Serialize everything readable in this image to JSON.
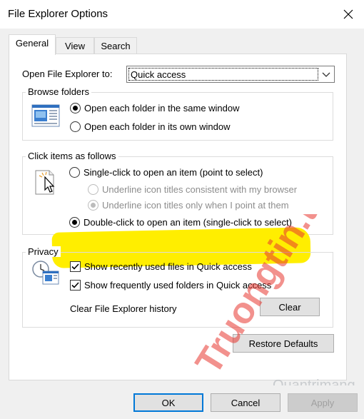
{
  "window": {
    "title": "File Explorer Options"
  },
  "tabs": [
    {
      "label": "General",
      "active": true
    },
    {
      "label": "View",
      "active": false
    },
    {
      "label": "Search",
      "active": false
    }
  ],
  "open_to": {
    "label": "Open File Explorer to:",
    "value": "Quick access"
  },
  "browse_folders": {
    "legend": "Browse folders",
    "options": [
      {
        "label": "Open each folder in the same window",
        "checked": true
      },
      {
        "label": "Open each folder in its own window",
        "checked": false
      }
    ]
  },
  "click_items": {
    "legend": "Click items as follows",
    "single_click": "Single-click to open an item (point to select)",
    "underline_browser": "Underline icon titles consistent with my browser",
    "underline_point": "Underline icon titles only when I point at them",
    "double_click": "Double-click to open an item (single-click to select)",
    "selected": "double_click"
  },
  "privacy": {
    "legend": "Privacy",
    "show_recent_files": "Show recently used files in Quick access",
    "show_frequent_folders": "Show frequently used folders in Quick access",
    "clear_history_label": "Clear File Explorer history",
    "clear_button": "Clear"
  },
  "buttons": {
    "restore_defaults": "Restore Defaults",
    "ok": "OK",
    "cancel": "Cancel",
    "apply": "Apply"
  },
  "watermark": {
    "text": "Truongtin.top",
    "subtext": "Quantrimang"
  },
  "colors": {
    "highlight": "#ffee00",
    "watermark": "#e8362f",
    "accent": "#0078d7"
  }
}
